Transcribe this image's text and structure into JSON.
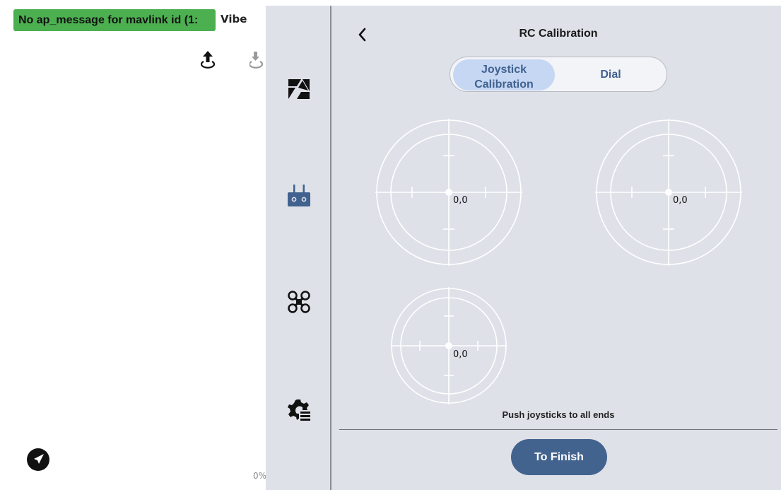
{
  "status": {
    "message": "No ap_message for mavlink id (1:",
    "vibe_label": "Vibe",
    "progress_percent": "0%"
  },
  "rail": {
    "items": [
      {
        "name": "camera",
        "icon": "camera-icon"
      },
      {
        "name": "remote-controller",
        "icon": "remote-controller-icon"
      },
      {
        "name": "drone",
        "icon": "drone-icon"
      },
      {
        "name": "settings",
        "icon": "settings-gear-icon"
      }
    ]
  },
  "panel": {
    "title": "RC Calibration",
    "tabs": [
      {
        "label": "Joystick Calibration",
        "active": true
      },
      {
        "label": "Dial",
        "active": false
      }
    ],
    "sticks": [
      {
        "label": "0,0",
        "x": 0,
        "y": 0
      },
      {
        "label": "0,0",
        "x": 0,
        "y": 0
      },
      {
        "label": "0,0",
        "x": 0,
        "y": 0
      }
    ],
    "hint": "Push joysticks to all ends",
    "finish_label": "To Finish"
  },
  "colors": {
    "banner": "#4caf50",
    "panel_bg": "#dfe1e9",
    "accent": "#43638f",
    "active_tab": "#c6d7f3"
  }
}
